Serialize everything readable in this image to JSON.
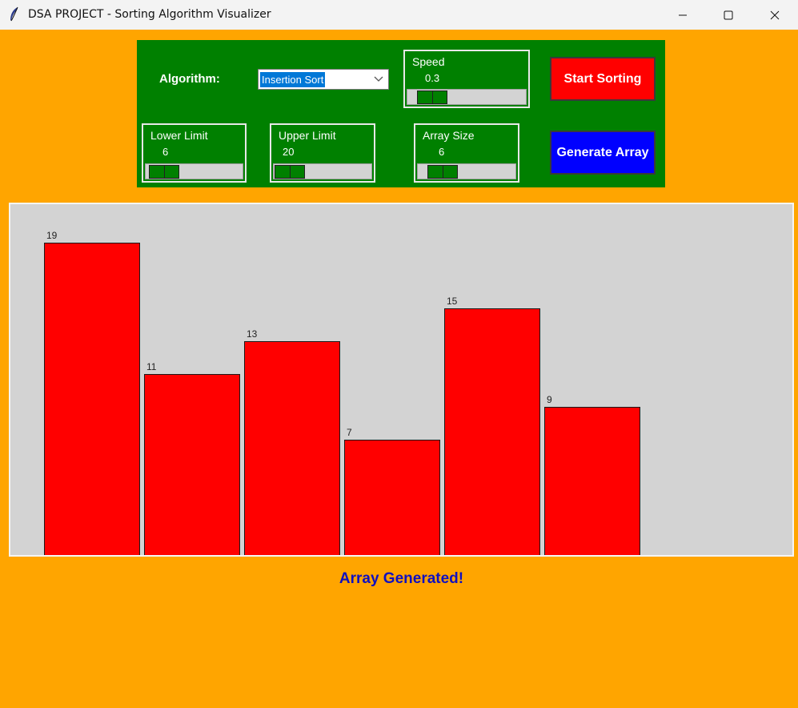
{
  "window": {
    "title": "DSA PROJECT - Sorting Algorithm Visualizer",
    "icon": "feather-icon"
  },
  "controls": {
    "algorithm_label": "Algorithm:",
    "algorithm_value": "Insertion Sort",
    "speed": {
      "label": "Speed",
      "value": "0.3"
    },
    "lower_limit": {
      "label": "Lower Limit",
      "value": "6"
    },
    "upper_limit": {
      "label": "Upper Limit",
      "value": "20"
    },
    "array_size": {
      "label": "Array Size",
      "value": "6"
    },
    "start_button": "Start Sorting",
    "generate_button": "Generate Array"
  },
  "chart_data": {
    "type": "bar",
    "values": [
      19,
      11,
      13,
      7,
      15,
      9
    ],
    "labels": [
      "19",
      "11",
      "13",
      "7",
      "15",
      "9"
    ],
    "bar_color": "#ff0000",
    "background": "#d3d3d3"
  },
  "status": "Array Generated!",
  "colors": {
    "window_bg": "#ffa500",
    "panel_bg": "#008000",
    "start_button": "#ff0000",
    "generate_button": "#0000ff",
    "status_text": "#1010c0"
  }
}
